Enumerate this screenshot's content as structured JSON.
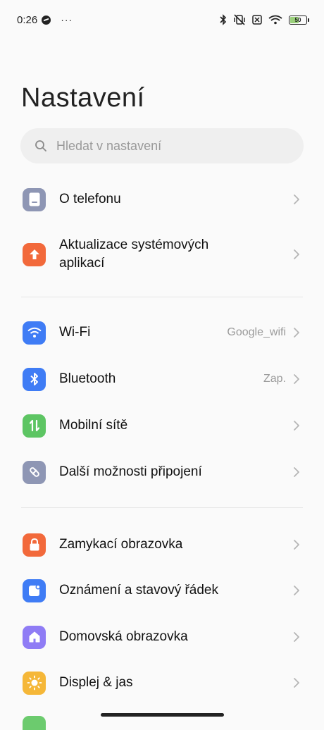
{
  "status_bar": {
    "time": "0:26",
    "dots": "···",
    "battery_text": "50",
    "battery_level": 0.5
  },
  "page": {
    "title": "Nastavení"
  },
  "search": {
    "placeholder": "Hledat v nastavení"
  },
  "items": [
    {
      "label": "O telefonu",
      "value": "",
      "icon": "phone-icon",
      "color": "#8e96b4"
    },
    {
      "label": "Aktualizace systémových\naplikací",
      "value": "",
      "icon": "arrow-up-icon",
      "color": "#f2693b"
    },
    {
      "label": "Wi-Fi",
      "value": "Google_wifi",
      "icon": "wifi-icon",
      "color": "#3f7cf5"
    },
    {
      "label": "Bluetooth",
      "value": "Zap.",
      "icon": "bluetooth-icon",
      "color": "#3f7cf5"
    },
    {
      "label": "Mobilní sítě",
      "value": "",
      "icon": "mobile-data-icon",
      "color": "#5dc563"
    },
    {
      "label": "Další možnosti připojení",
      "value": "",
      "icon": "link-icon",
      "color": "#8e96b4"
    },
    {
      "label": "Zamykací obrazovka",
      "value": "",
      "icon": "lock-icon",
      "color": "#f2693b"
    },
    {
      "label": "Oznámení a stavový řádek",
      "value": "",
      "icon": "notification-icon",
      "color": "#3f7cf5"
    },
    {
      "label": "Domovská obrazovka",
      "value": "",
      "icon": "home-icon",
      "color": "#8f7cf5"
    },
    {
      "label": "Displej & jas",
      "value": "",
      "icon": "sun-icon",
      "color": "#f5b738"
    }
  ]
}
